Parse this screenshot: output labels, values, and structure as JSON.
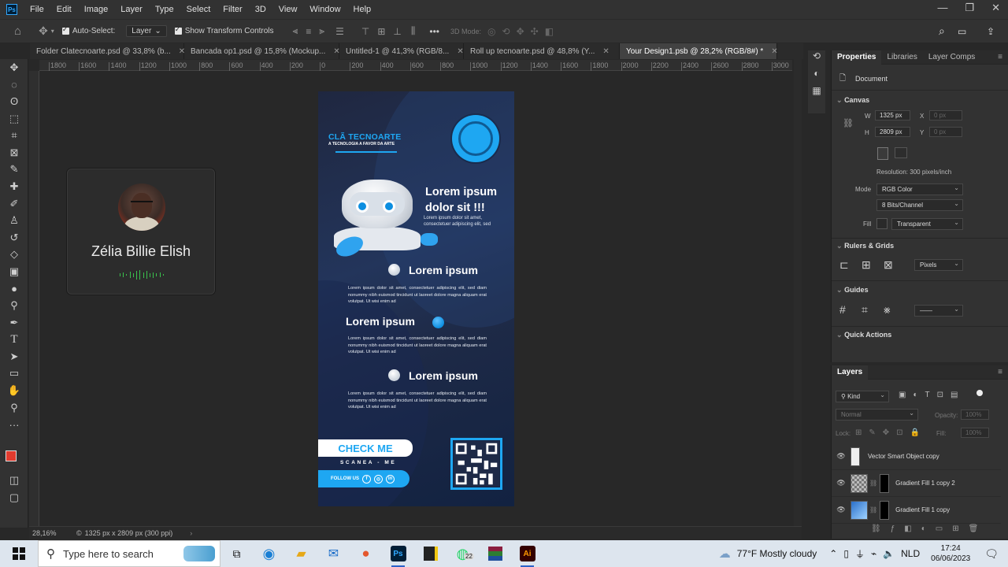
{
  "menubar": {
    "app_icon": "Ps",
    "items": [
      "File",
      "Edit",
      "Image",
      "Layer",
      "Type",
      "Select",
      "Filter",
      "3D",
      "View",
      "Window",
      "Help"
    ]
  },
  "options": {
    "auto_select_label": "Auto-Select:",
    "auto_select_value": "Layer",
    "show_transform_label": "Show Transform Controls",
    "mode_3d_label": "3D Mode:"
  },
  "tabs": [
    {
      "label": "Folder Clatecnoarte.psd @ 33,8% (b...",
      "active": false
    },
    {
      "label": "Bancada op1.psd @ 15,8% (Mockup...",
      "active": false
    },
    {
      "label": "Untitled-1 @ 41,3% (RGB/8...",
      "active": false
    },
    {
      "label": "Roll up tecnoarte.psd @ 48,8% (Y...",
      "active": false
    },
    {
      "label": "Your Design1.psb @ 28,2% (RGB/8#) *",
      "active": true
    }
  ],
  "ruler": {
    "top_ticks": [
      "1800",
      "1600",
      "1400",
      "1200",
      "1000",
      "800",
      "600",
      "400",
      "200",
      "0",
      "200",
      "400",
      "600",
      "800",
      "1000",
      "1200",
      "1400",
      "1600",
      "1800",
      "2000",
      "2200",
      "2400",
      "2600",
      "2800",
      "3000"
    ]
  },
  "status": {
    "zoom": "28,16%",
    "doc_info": "1325 px x 2809 px (300 ppi)"
  },
  "webcam": {
    "name": "Zélia Billie Elish",
    "wave_levels": [
      0.3,
      0.5,
      0.2,
      0.7,
      0.4,
      0.9,
      1.0,
      0.6,
      0.8,
      0.4,
      0.6,
      0.3,
      0.5,
      0.2
    ],
    "accent_color": "#3ac24d"
  },
  "design": {
    "brand_title": "CLÃ TECNOARTE",
    "brand_sub": "A TECNOLOGIA A FAVOR DA ARTE",
    "hero_title_1": "Lorem ipsum",
    "hero_title_2": "dolor sit  !!!",
    "hero_sub": "Lorem ipsum dolor sit amet, consectetuer adipiscing elit, sed",
    "features": [
      {
        "title": "Lorem ipsum",
        "body": "Lorem ipsum dolor sit amet, consectetuer adipiscing elit, sed diam nonummy nibh euismod tincidunt ut laoreet dolore magna aliquam erat volutpat. Ut wisi enim ad"
      },
      {
        "title": "Lorem ipsum",
        "body": "Lorem ipsum dolor sit amet, consectetuer adipiscing elit, sed diam nonummy nibh euismod tincidunt ut laoreet dolore magna aliquam erat volutpat. Ut wisi enim ad"
      },
      {
        "title": "Lorem ipsum",
        "body": "Lorem ipsum dolor sit amet, consectetuer adipiscing elit, sed diam nonummy nibh euismod tincidunt ut laoreet dolore magna aliquam erat volutpat. Ut wisi enim ad"
      }
    ],
    "cta": "CHECK ME",
    "cta_sub": "SCANEA - ME",
    "follow": "FOLLOW US",
    "brand_color": "#1ea7f2"
  },
  "properties": {
    "tabs": [
      "Properties",
      "Libraries",
      "Layer Comps"
    ],
    "document_label": "Document",
    "canvas_title": "Canvas",
    "w_label": "W",
    "w_value": "1325 px",
    "h_label": "H",
    "h_value": "2809 px",
    "x_label": "X",
    "x_placeholder": "0 px",
    "y_label": "Y",
    "y_placeholder": "0 px",
    "resolution": "Resolution: 300 pixels/inch",
    "mode_label": "Mode",
    "mode_value": "RGB Color",
    "bits_value": "8 Bits/Channel",
    "fill_label": "Fill",
    "fill_value": "Transparent",
    "rulers_title": "Rulers & Grids",
    "units_value": "Pixels",
    "guides_title": "Guides",
    "quick_actions_title": "Quick Actions"
  },
  "layers": {
    "title": "Layers",
    "kind_label": "Kind",
    "blend_value": "Normal",
    "opacity_label": "Opacity:",
    "opacity_value": "100%",
    "lock_label": "Lock:",
    "fill_label": "Fill:",
    "fill_value": "100%",
    "rows": [
      {
        "name": "Vector Smart Object copy",
        "has_mask": false
      },
      {
        "name": "Gradient Fill 1 copy 2",
        "has_mask": true
      },
      {
        "name": "Gradient Fill 1 copy",
        "has_mask": true
      }
    ]
  },
  "taskbar": {
    "search_placeholder": "Type here to search",
    "whatsapp_badge": "22",
    "weather": "77°F  Mostly cloudy",
    "language": "NLD",
    "time": "17:24",
    "date": "06/06/2023"
  }
}
